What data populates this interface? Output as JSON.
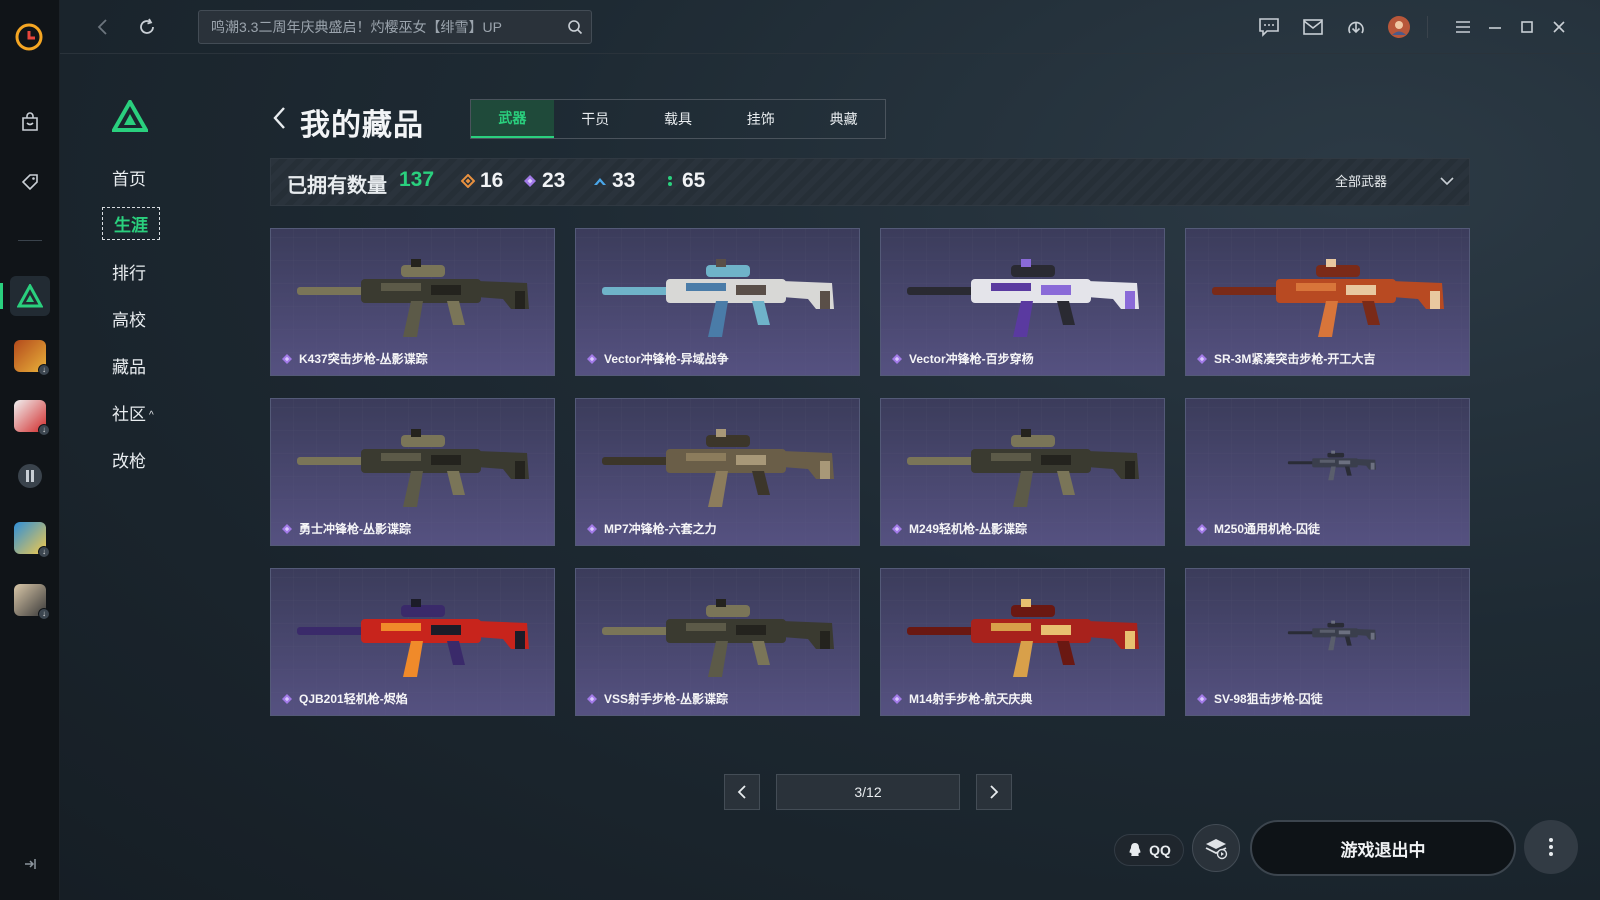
{
  "topbar": {
    "search_value": "鸣潮3.3二周年庆典盛启！灼樱巫女【绯雪】UP"
  },
  "sidenav": {
    "items": [
      {
        "label": "首页"
      },
      {
        "label": "生涯"
      },
      {
        "label": "排行"
      },
      {
        "label": "高校"
      },
      {
        "label": "藏品"
      },
      {
        "label": "社区"
      },
      {
        "label": "改枪"
      }
    ],
    "active_index": 1
  },
  "page": {
    "title": "我的藏品",
    "tabs": [
      "武器",
      "干员",
      "载具",
      "挂饰",
      "典藏"
    ],
    "active_tab": 0
  },
  "stats": {
    "owned_label": "已拥有数量",
    "owned_count": "137",
    "rarities": [
      {
        "icon": "orange-diamond-icon",
        "color": "#e9913f",
        "count": "16"
      },
      {
        "icon": "purple-diamond-icon",
        "color": "#a27ae8",
        "count": "23"
      },
      {
        "icon": "blue-chevron-icon",
        "color": "#4aa6e8",
        "count": "33"
      },
      {
        "icon": "green-dots-icon",
        "color": "#2ad07e",
        "count": "65"
      }
    ],
    "filter_label": "全部武器"
  },
  "cards": [
    {
      "name": "K437突击步枪-丛影谍踪",
      "skin": "camo"
    },
    {
      "name": "Vector冲锋枪-异域战争",
      "skin": "white-blue"
    },
    {
      "name": "Vector冲锋枪-百步穿杨",
      "skin": "white-purple"
    },
    {
      "name": "SR-3M紧凑突击步枪-开工大吉",
      "skin": "red-orange"
    },
    {
      "name": "勇士冲锋枪-丛影谍踪",
      "skin": "camo"
    },
    {
      "name": "MP7冲锋枪-六套之力",
      "skin": "tan-camo"
    },
    {
      "name": "M249轻机枪-丛影谍踪",
      "skin": "camo"
    },
    {
      "name": "M250通用机枪-囚徒",
      "skin": "small-dark"
    },
    {
      "name": "QJB201轻机枪-烬焰",
      "skin": "flame"
    },
    {
      "name": "VSS射手步枪-丛影谍踪",
      "skin": "camo"
    },
    {
      "name": "M14射手步枪-航天庆典",
      "skin": "red-gold"
    },
    {
      "name": "SV-98狙击步枪-囚徒",
      "skin": "small-dark"
    }
  ],
  "pager": {
    "page_text": "3/12"
  },
  "bottom": {
    "qq_label": "QQ",
    "exit_label": "游戏退出中"
  },
  "colors": {
    "accent": "#2ad07e",
    "rarity_purple": "#a27ae8"
  }
}
